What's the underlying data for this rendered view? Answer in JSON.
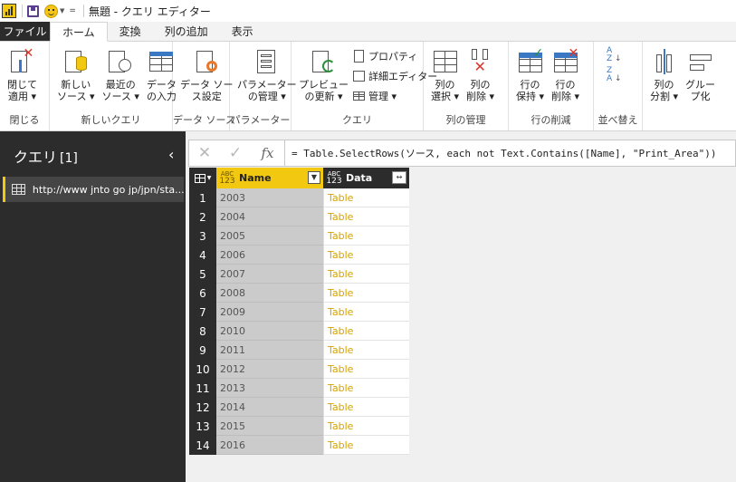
{
  "titlebar": {
    "title": "無題 - クエリ エディター",
    "customize_glyph": "="
  },
  "menu": {
    "tabs": [
      {
        "label": "ファイル"
      },
      {
        "label": "ホーム"
      },
      {
        "label": "変換"
      },
      {
        "label": "列の追加"
      },
      {
        "label": "表示"
      }
    ],
    "active_tab": "ホーム"
  },
  "ribbon": {
    "groups": {
      "close": {
        "label": "閉じる",
        "apply": "閉じて\n適用 ▾"
      },
      "new_query": {
        "label": "新しいクエリ",
        "new_source": "新しい\nソース ▾",
        "recent_sources": "最近の\nソース ▾",
        "enter_data": "データ\nの入力"
      },
      "data_sources": {
        "label": "データ ソース",
        "settings": "データ ソー\nス設定"
      },
      "parameters": {
        "label": "パラメーター",
        "manage": "パラメーター\nの管理 ▾"
      },
      "query": {
        "label": "クエリ",
        "refresh_preview": "プレビュー\nの更新 ▾",
        "properties": "プロパティ",
        "advanced_editor": "詳細エディター",
        "manage": "管理 ▾"
      },
      "manage_columns": {
        "label": "列の管理",
        "choose_columns": "列の\n選択 ▾",
        "remove_columns": "列の\n削除 ▾"
      },
      "reduce_rows": {
        "label": "行の削減",
        "keep_rows": "行の\n保持 ▾",
        "remove_rows": "行の\n削除 ▾"
      },
      "sort": {
        "label": "並べ替え"
      },
      "transform": {
        "split_column": "列の\n分割 ▾",
        "group_by": "グルー\nプ化"
      }
    }
  },
  "query_pane": {
    "title": "クエリ",
    "count": "[1]",
    "collapse_glyph": "‹",
    "items": [
      {
        "label": "http://www jnto go jp/jpn/sta..."
      }
    ]
  },
  "formula_bar": {
    "cancel_glyph": "✕",
    "commit_glyph": "✓",
    "fx_glyph": "fx",
    "formula": "= Table.SelectRows(ソース, each not Text.Contains([Name], \"Print_Area\"))"
  },
  "grid": {
    "columns": [
      {
        "name": "Name",
        "type_top": "ABC",
        "type_bottom": "123"
      },
      {
        "name": "Data",
        "type_top": "ABC",
        "type_bottom": "123"
      }
    ],
    "rows": [
      {
        "n": "1",
        "name": "2003",
        "data": "Table"
      },
      {
        "n": "2",
        "name": "2004",
        "data": "Table"
      },
      {
        "n": "3",
        "name": "2005",
        "data": "Table"
      },
      {
        "n": "4",
        "name": "2006",
        "data": "Table"
      },
      {
        "n": "5",
        "name": "2007",
        "data": "Table"
      },
      {
        "n": "6",
        "name": "2008",
        "data": "Table"
      },
      {
        "n": "7",
        "name": "2009",
        "data": "Table"
      },
      {
        "n": "8",
        "name": "2010",
        "data": "Table"
      },
      {
        "n": "9",
        "name": "2011",
        "data": "Table"
      },
      {
        "n": "10",
        "name": "2012",
        "data": "Table"
      },
      {
        "n": "11",
        "name": "2013",
        "data": "Table"
      },
      {
        "n": "12",
        "name": "2014",
        "data": "Table"
      },
      {
        "n": "13",
        "name": "2015",
        "data": "Table"
      },
      {
        "n": "14",
        "name": "2016",
        "data": "Table"
      }
    ]
  },
  "colors": {
    "accent": "#f2c811",
    "dark_pane": "#2c2c2c",
    "table_link": "#d6a300"
  }
}
